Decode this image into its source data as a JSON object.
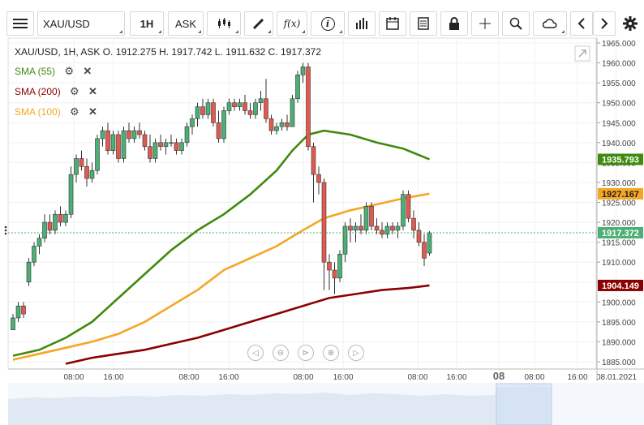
{
  "toolbar": {
    "menu_icon": "hamburger-menu-icon",
    "symbol": "XAU/USD",
    "timeframe": "1H",
    "price_type": "ASK",
    "fx_label": "f(x)",
    "info_label": "i"
  },
  "header": {
    "ohlc": "XAU/USD, 1H, ASK   O. 1912.275 H. 1917.742 L. 1911.632 C. 1917.372"
  },
  "indicators": [
    {
      "label": "SMA (55)",
      "color": "#3f8a10"
    },
    {
      "label": "SMA (200)",
      "color": "#8b0000"
    },
    {
      "label": "SMA (100)",
      "color": "#f5a623"
    }
  ],
  "price_axis": {
    "ticks": [
      "1965.000",
      "1960.000",
      "1955.000",
      "1950.000",
      "1945.000",
      "1940.000",
      "1935.000",
      "1930.000",
      "1925.000",
      "1920.000",
      "1915.000",
      "1910.000",
      "1905.000",
      "1900.000",
      "1895.000",
      "1890.000",
      "1885.000"
    ],
    "tags": [
      {
        "value": "1935.793",
        "bg": "#3f8a10",
        "fg": "#ffffff"
      },
      {
        "value": "1927.167",
        "bg": "#f5a623",
        "fg": "#222222"
      },
      {
        "value": "1917.372",
        "bg": "#4caf75",
        "fg": "#ffffff"
      },
      {
        "value": "1904.149",
        "bg": "#8b0000",
        "fg": "#ffffff"
      }
    ]
  },
  "time_axis": {
    "labels": [
      "08:00",
      "16:00",
      "08:00",
      "16:00",
      "08:00",
      "16:00",
      "08:00",
      "16:00",
      "08",
      "08:00",
      "16:00",
      "08.01.2021"
    ]
  },
  "chart_data": {
    "type": "candlestick",
    "title": "XAU/USD, 1H, ASK",
    "ylim": [
      1884,
      1967
    ],
    "candles": [
      {
        "o": 1893,
        "h": 1897,
        "l": 1893,
        "c": 1896
      },
      {
        "o": 1896,
        "h": 1900,
        "l": 1895,
        "c": 1899
      },
      {
        "o": 1899,
        "h": 1900,
        "l": 1896,
        "c": 1897
      },
      {
        "o": 1905,
        "h": 1911,
        "l": 1904,
        "c": 1910
      },
      {
        "o": 1910,
        "h": 1915,
        "l": 1909,
        "c": 1914
      },
      {
        "o": 1914,
        "h": 1917,
        "l": 1912,
        "c": 1916
      },
      {
        "o": 1916,
        "h": 1922,
        "l": 1915,
        "c": 1920
      },
      {
        "o": 1920,
        "h": 1922,
        "l": 1917,
        "c": 1918
      },
      {
        "o": 1918,
        "h": 1923,
        "l": 1917,
        "c": 1922
      },
      {
        "o": 1922,
        "h": 1924,
        "l": 1919,
        "c": 1920
      },
      {
        "o": 1920,
        "h": 1923,
        "l": 1919,
        "c": 1922
      },
      {
        "o": 1922,
        "h": 1934,
        "l": 1921,
        "c": 1932
      },
      {
        "o": 1932,
        "h": 1937,
        "l": 1930,
        "c": 1936
      },
      {
        "o": 1936,
        "h": 1938,
        "l": 1933,
        "c": 1934
      },
      {
        "o": 1934,
        "h": 1936,
        "l": 1929,
        "c": 1931
      },
      {
        "o": 1931,
        "h": 1935,
        "l": 1930,
        "c": 1933
      },
      {
        "o": 1933,
        "h": 1942,
        "l": 1932,
        "c": 1941
      },
      {
        "o": 1941,
        "h": 1944,
        "l": 1939,
        "c": 1943
      },
      {
        "o": 1943,
        "h": 1945,
        "l": 1937,
        "c": 1938
      },
      {
        "o": 1938,
        "h": 1943,
        "l": 1937,
        "c": 1942
      },
      {
        "o": 1942,
        "h": 1943,
        "l": 1935,
        "c": 1936
      },
      {
        "o": 1936,
        "h": 1944,
        "l": 1935,
        "c": 1943
      },
      {
        "o": 1943,
        "h": 1945,
        "l": 1940,
        "c": 1941
      },
      {
        "o": 1941,
        "h": 1944,
        "l": 1940,
        "c": 1943
      },
      {
        "o": 1943,
        "h": 1945,
        "l": 1941,
        "c": 1942
      },
      {
        "o": 1942,
        "h": 1943,
        "l": 1938,
        "c": 1939
      },
      {
        "o": 1939,
        "h": 1942,
        "l": 1935,
        "c": 1936
      },
      {
        "o": 1936,
        "h": 1941,
        "l": 1935,
        "c": 1940
      },
      {
        "o": 1940,
        "h": 1942,
        "l": 1938,
        "c": 1939
      },
      {
        "o": 1939,
        "h": 1941,
        "l": 1937,
        "c": 1940
      },
      {
        "o": 1940,
        "h": 1942,
        "l": 1939,
        "c": 1940
      },
      {
        "o": 1940,
        "h": 1941,
        "l": 1937,
        "c": 1938
      },
      {
        "o": 1938,
        "h": 1941,
        "l": 1937,
        "c": 1940
      },
      {
        "o": 1940,
        "h": 1945,
        "l": 1939,
        "c": 1944
      },
      {
        "o": 1944,
        "h": 1947,
        "l": 1942,
        "c": 1946
      },
      {
        "o": 1946,
        "h": 1950,
        "l": 1944,
        "c": 1949
      },
      {
        "o": 1949,
        "h": 1951,
        "l": 1946,
        "c": 1947
      },
      {
        "o": 1947,
        "h": 1951,
        "l": 1946,
        "c": 1950
      },
      {
        "o": 1950,
        "h": 1951,
        "l": 1944,
        "c": 1945
      },
      {
        "o": 1945,
        "h": 1948,
        "l": 1940,
        "c": 1941
      },
      {
        "o": 1941,
        "h": 1949,
        "l": 1940,
        "c": 1948
      },
      {
        "o": 1948,
        "h": 1951,
        "l": 1947,
        "c": 1950
      },
      {
        "o": 1950,
        "h": 1951,
        "l": 1948,
        "c": 1949
      },
      {
        "o": 1949,
        "h": 1951,
        "l": 1948,
        "c": 1950
      },
      {
        "o": 1950,
        "h": 1952,
        "l": 1947,
        "c": 1948
      },
      {
        "o": 1948,
        "h": 1950,
        "l": 1946,
        "c": 1947
      },
      {
        "o": 1947,
        "h": 1951,
        "l": 1946,
        "c": 1950
      },
      {
        "o": 1950,
        "h": 1953,
        "l": 1948,
        "c": 1951
      },
      {
        "o": 1951,
        "h": 1956,
        "l": 1945,
        "c": 1946
      },
      {
        "o": 1946,
        "h": 1947,
        "l": 1942,
        "c": 1943
      },
      {
        "o": 1943,
        "h": 1945,
        "l": 1942,
        "c": 1944
      },
      {
        "o": 1944,
        "h": 1946,
        "l": 1943,
        "c": 1945
      },
      {
        "o": 1945,
        "h": 1947,
        "l": 1943,
        "c": 1944
      },
      {
        "o": 1944,
        "h": 1952,
        "l": 1944,
        "c": 1951
      },
      {
        "o": 1951,
        "h": 1958,
        "l": 1950,
        "c": 1957
      },
      {
        "o": 1957,
        "h": 1960,
        "l": 1955,
        "c": 1959
      },
      {
        "o": 1959,
        "h": 1960,
        "l": 1938,
        "c": 1939
      },
      {
        "o": 1939,
        "h": 1940,
        "l": 1925,
        "c": 1932
      },
      {
        "o": 1932,
        "h": 1934,
        "l": 1927,
        "c": 1930
      },
      {
        "o": 1930,
        "h": 1931,
        "l": 1903,
        "c": 1910
      },
      {
        "o": 1910,
        "h": 1912,
        "l": 1903,
        "c": 1908
      },
      {
        "o": 1908,
        "h": 1910,
        "l": 1902,
        "c": 1906
      },
      {
        "o": 1906,
        "h": 1913,
        "l": 1905,
        "c": 1912
      },
      {
        "o": 1912,
        "h": 1920,
        "l": 1910,
        "c": 1919
      },
      {
        "o": 1919,
        "h": 1921,
        "l": 1915,
        "c": 1918
      },
      {
        "o": 1918,
        "h": 1920,
        "l": 1915,
        "c": 1919
      },
      {
        "o": 1919,
        "h": 1922,
        "l": 1917,
        "c": 1918
      },
      {
        "o": 1918,
        "h": 1925,
        "l": 1917,
        "c": 1924
      },
      {
        "o": 1924,
        "h": 1925,
        "l": 1918,
        "c": 1919
      },
      {
        "o": 1919,
        "h": 1921,
        "l": 1917,
        "c": 1918
      },
      {
        "o": 1918,
        "h": 1920,
        "l": 1916,
        "c": 1917
      },
      {
        "o": 1917,
        "h": 1920,
        "l": 1916,
        "c": 1919
      },
      {
        "o": 1919,
        "h": 1920,
        "l": 1917,
        "c": 1918
      },
      {
        "o": 1918,
        "h": 1920,
        "l": 1916,
        "c": 1919
      },
      {
        "o": 1919,
        "h": 1928,
        "l": 1918,
        "c": 1927
      },
      {
        "o": 1927,
        "h": 1928,
        "l": 1920,
        "c": 1921
      },
      {
        "o": 1921,
        "h": 1923,
        "l": 1916,
        "c": 1918
      },
      {
        "o": 1918,
        "h": 1920,
        "l": 1914,
        "c": 1915
      },
      {
        "o": 1915,
        "h": 1917,
        "l": 1909,
        "c": 1911
      },
      {
        "o": 1912.275,
        "h": 1917.742,
        "l": 1911.632,
        "c": 1917.372
      }
    ],
    "sma": [
      {
        "name": "SMA (55)",
        "color": "#3f8a10",
        "points": [
          [
            0,
            1886.5
          ],
          [
            5,
            1888
          ],
          [
            10,
            1891
          ],
          [
            15,
            1895
          ],
          [
            20,
            1901
          ],
          [
            25,
            1907
          ],
          [
            30,
            1913
          ],
          [
            35,
            1918
          ],
          [
            40,
            1922
          ],
          [
            45,
            1927
          ],
          [
            50,
            1933
          ],
          [
            53,
            1938
          ],
          [
            56,
            1942
          ],
          [
            59,
            1943
          ],
          [
            64,
            1942
          ],
          [
            69,
            1940
          ],
          [
            74,
            1938.5
          ],
          [
            79,
            1935.8
          ]
        ]
      },
      {
        "name": "SMA (200)",
        "color": "#8b0000",
        "points": [
          [
            10,
            1884.5
          ],
          [
            15,
            1886
          ],
          [
            20,
            1887
          ],
          [
            25,
            1888
          ],
          [
            30,
            1889.5
          ],
          [
            35,
            1891
          ],
          [
            40,
            1893
          ],
          [
            45,
            1895
          ],
          [
            50,
            1897
          ],
          [
            55,
            1899
          ],
          [
            60,
            1901
          ],
          [
            65,
            1902
          ],
          [
            70,
            1903
          ],
          [
            75,
            1903.5
          ],
          [
            79,
            1904.15
          ]
        ]
      },
      {
        "name": "SMA (100)",
        "color": "#f5a623",
        "points": [
          [
            0,
            1885.5
          ],
          [
            5,
            1887
          ],
          [
            10,
            1888.5
          ],
          [
            15,
            1890
          ],
          [
            20,
            1892
          ],
          [
            25,
            1895
          ],
          [
            30,
            1899
          ],
          [
            35,
            1903
          ],
          [
            40,
            1908
          ],
          [
            45,
            1911
          ],
          [
            50,
            1914
          ],
          [
            55,
            1918
          ],
          [
            59,
            1921
          ],
          [
            64,
            1923
          ],
          [
            69,
            1924.5
          ],
          [
            74,
            1926
          ],
          [
            79,
            1927.17
          ]
        ]
      }
    ]
  }
}
